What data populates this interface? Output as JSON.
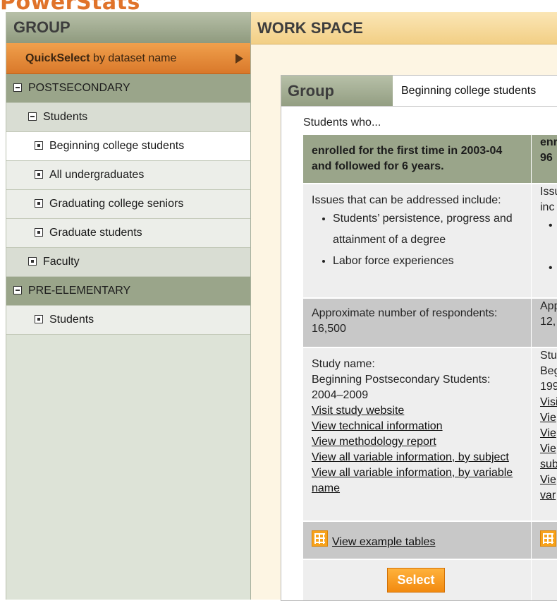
{
  "logo": "PowerStats",
  "group_panel": {
    "title": "GROUP",
    "quickselect": {
      "bold": "QuickSelect",
      "rest": " by dataset name"
    },
    "tree": [
      {
        "label": "POSTSECONDARY",
        "level": 0,
        "state": "minus"
      },
      {
        "label": "Students",
        "level": 1,
        "state": "minus"
      },
      {
        "label": "Beginning college students",
        "level": 2,
        "state": "plus",
        "selected": true
      },
      {
        "label": "All undergraduates",
        "level": 2,
        "state": "plus"
      },
      {
        "label": "Graduating college seniors",
        "level": 2,
        "state": "plus"
      },
      {
        "label": "Graduate students",
        "level": 2,
        "state": "plus"
      },
      {
        "label": "Faculty",
        "level": 1,
        "state": "plus"
      },
      {
        "label": "PRE-ELEMENTARY",
        "level": 0,
        "state": "minus"
      },
      {
        "label": "Students",
        "level": 2,
        "state": "plus"
      }
    ]
  },
  "workspace": {
    "title": "WORK SPACE",
    "group_label": "Group",
    "group_value": "Beginning college students",
    "students_who": "Students who...",
    "col1": {
      "enrolled": "enrolled for the first time in 2003-04 and followed for 6 years.",
      "issues_intro": "Issues that can be addressed include:",
      "issues": [
        "Students’ persistence, progress and attainment of a degree",
        "Labor force experiences"
      ],
      "approx_label": "Approximate number of respondents:",
      "approx_value": "16,500",
      "study_label": "Study name:",
      "study_name": "Beginning Postsecondary Students: 2004–2009",
      "links": [
        "Visit study website",
        "View technical information",
        "View methodology report",
        "View all variable information, by subject",
        "View all variable information, by variable name"
      ],
      "example_tables": "View example tables",
      "select": "Select"
    },
    "col2": {
      "enrolled_1": "enr",
      "enrolled_2": "96",
      "issues_1": "Issu",
      "issues_2": "inc",
      "approx_1": "App",
      "approx_2": "12,",
      "study_1": "Stu",
      "study_2": "Beg",
      "study_3": "199",
      "links": [
        "Visi",
        "Vie",
        "Vie",
        "Vie",
        "sub",
        "Vie",
        "var"
      ]
    }
  }
}
